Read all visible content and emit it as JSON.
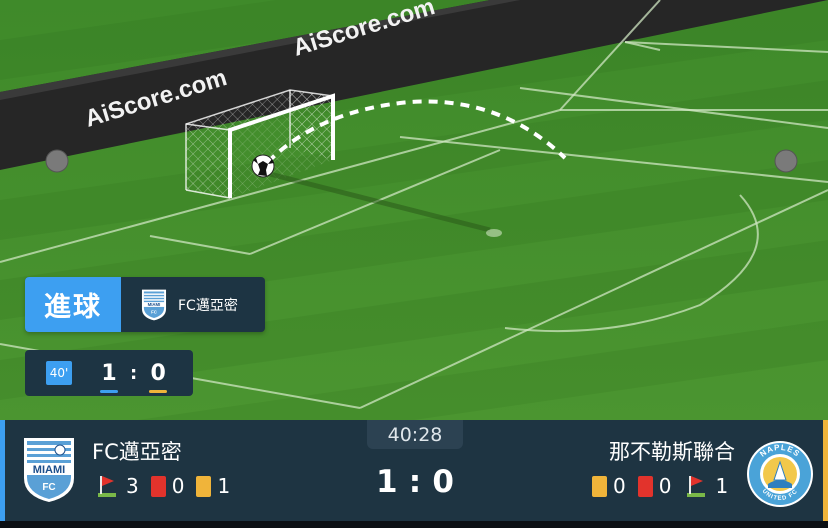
{
  "banner": {
    "brand_1": "AiScore.com",
    "brand_2": "AiScore.com"
  },
  "event": {
    "label": "進球",
    "team": "FC邁亞密"
  },
  "mini_score": {
    "minute": "40'",
    "home": "1",
    "sep": ":",
    "away": "0"
  },
  "scoreboard": {
    "clock": "40:28",
    "home": {
      "name": "FC邁亞密",
      "logo_text": "MIAMI",
      "logo_sub": "FC",
      "corners": "3",
      "red": "0",
      "yellow": "1"
    },
    "away": {
      "name": "那不勒斯聯合",
      "logo_top": "NAPLES",
      "logo_bottom": "UNITED FC",
      "yellow": "0",
      "red": "0",
      "corners": "1"
    },
    "score_home": "1",
    "score_sep": ":",
    "score_away": "0"
  },
  "colors": {
    "home_accent": "#3d9ff1",
    "away_accent": "#f0b43a",
    "panel": "#1e3442",
    "red_card": "#e2332c",
    "yellow_card": "#f0b43a",
    "pitch": "#4a8f2e"
  }
}
